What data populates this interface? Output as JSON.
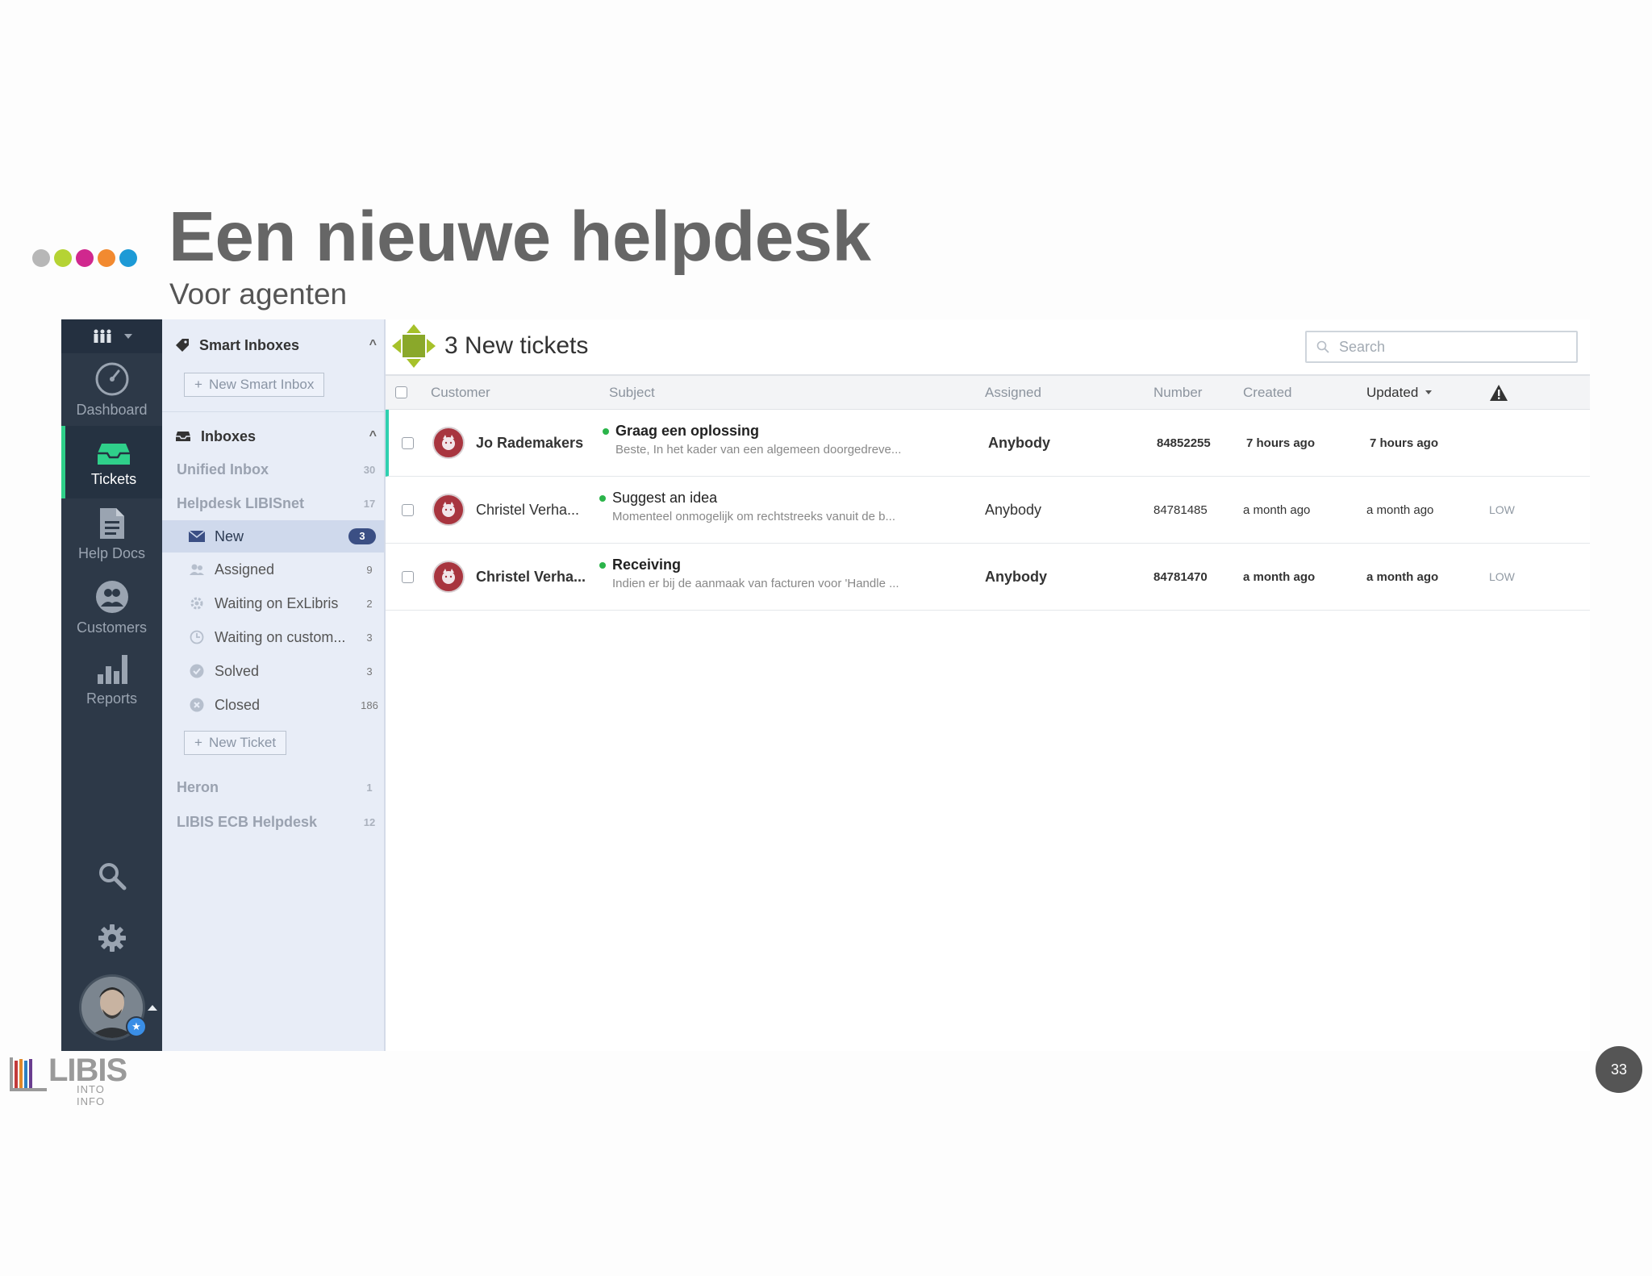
{
  "slide": {
    "title": "Een nieuwe helpdesk",
    "subtitle": "Voor agenten",
    "page_number": "33",
    "logo_text": "LIBIS",
    "logo_tagline": "INTO INFO",
    "dot_colors": [
      "#b7b7b7",
      "#b5d334",
      "#d0288e",
      "#f28a30",
      "#1d9ad6"
    ]
  },
  "nav": {
    "items": [
      {
        "label": "Dashboard",
        "icon": "dashboard-gauge-icon"
      },
      {
        "label": "Tickets",
        "icon": "inbox-tray-icon"
      },
      {
        "label": "Help Docs",
        "icon": "document-icon"
      },
      {
        "label": "Customers",
        "icon": "customers-icon"
      },
      {
        "label": "Reports",
        "icon": "bar-chart-icon"
      }
    ],
    "active": "Tickets",
    "accent": "#2fd08a"
  },
  "sidebar": {
    "smart_inboxes": {
      "label": "Smart Inboxes",
      "button": "New Smart Inbox"
    },
    "inboxes": {
      "label": "Inboxes"
    },
    "unified": {
      "label": "Unified Inbox",
      "count": "30"
    },
    "helpdesk": {
      "label": "Helpdesk LIBISnet",
      "count": "17"
    },
    "folders": [
      {
        "label": "New",
        "count": "3"
      },
      {
        "label": "Assigned",
        "count": "9"
      },
      {
        "label": "Waiting on ExLibris",
        "count": "2"
      },
      {
        "label": "Waiting on custom...",
        "count": "3"
      },
      {
        "label": "Solved",
        "count": "3"
      },
      {
        "label": "Closed",
        "count": "186"
      }
    ],
    "new_ticket": "New Ticket",
    "other_inboxes": [
      {
        "label": "Heron",
        "count": "1"
      },
      {
        "label": "LIBIS ECB Helpdesk",
        "count": "12"
      }
    ]
  },
  "main": {
    "title": "3 New tickets",
    "search_placeholder": "Search",
    "columns": {
      "customer": "Customer",
      "subject": "Subject",
      "assigned": "Assigned",
      "number": "Number",
      "created": "Created",
      "updated": "Updated"
    },
    "sort_column": "Updated",
    "tickets": [
      {
        "customer": "Jo Rademakers",
        "subject": "Graag een oplossing",
        "preview": "Beste, In het kader van een algemeen doorgedreve...",
        "assigned": "Anybody",
        "number": "84852255",
        "created": "7 hours ago",
        "updated": "7 hours ago",
        "priority": ""
      },
      {
        "customer": "Christel Verha...",
        "subject": "Suggest an idea",
        "preview": "Momenteel onmogelijk om rechtstreeks vanuit de b...",
        "assigned": "Anybody",
        "number": "84781485",
        "created": "a month ago",
        "updated": "a month ago",
        "priority": "LOW"
      },
      {
        "customer": "Christel Verha...",
        "subject": "Receiving",
        "preview": "Indien er bij de aanmaak van facturen voor 'Handle ...",
        "assigned": "Anybody",
        "number": "84781470",
        "created": "a month ago",
        "updated": "a month ago",
        "priority": "LOW"
      }
    ]
  }
}
